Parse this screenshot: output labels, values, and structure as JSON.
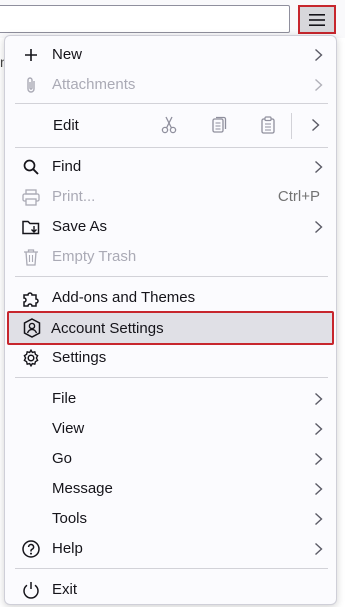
{
  "menu": {
    "items": {
      "new": "New",
      "attachments": "Attachments",
      "edit": "Edit",
      "find": "Find",
      "print": "Print...",
      "print_shortcut": "Ctrl+P",
      "save_as": "Save As",
      "empty_trash": "Empty Trash",
      "addons": "Add-ons and Themes",
      "account_settings": "Account Settings",
      "settings": "Settings",
      "file": "File",
      "view": "View",
      "go": "Go",
      "message": "Message",
      "tools": "Tools",
      "help": "Help",
      "exit": "Exit"
    }
  },
  "colors": {
    "highlight_border": "#c7262d",
    "highlight_bg": "#e0e0e6",
    "panel_bg": "#fbfbfe",
    "disabled_text": "#8f8f9d"
  },
  "icons": [
    "hamburger-icon",
    "plus-icon",
    "paperclip-icon",
    "scissors-icon",
    "copy-icon",
    "paste-icon",
    "magnifier-icon",
    "printer-icon",
    "save-folder-icon",
    "trash-icon",
    "puzzle-icon",
    "account-icon",
    "gear-icon",
    "help-circle-icon",
    "power-icon",
    "chevron-right-icon"
  ]
}
